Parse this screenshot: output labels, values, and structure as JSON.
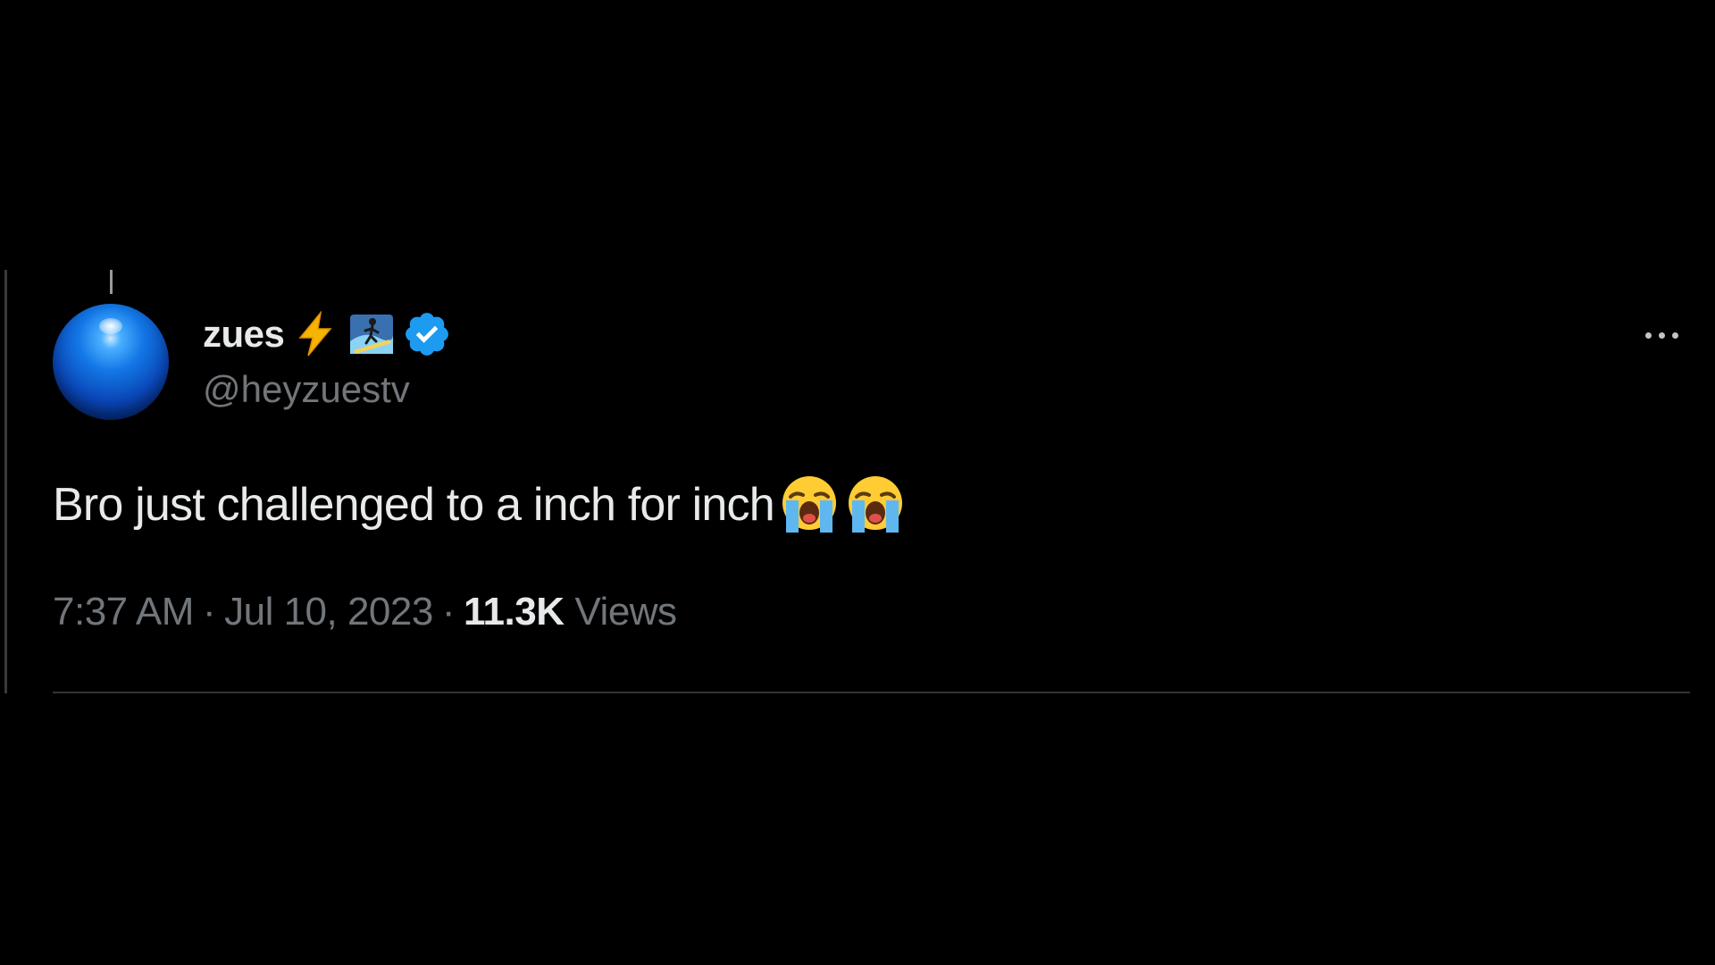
{
  "tweet": {
    "author": {
      "display_name": "zues",
      "handle": "@heyzuestv",
      "name_emojis": [
        "lightning-bolt-icon",
        "person-surfing-icon"
      ],
      "verified": true
    },
    "text": "Bro just challenged to a inch for inch",
    "text_emojis": [
      "loudly-crying-face-icon",
      "loudly-crying-face-icon"
    ],
    "time": "7:37 AM",
    "date": "Jul 10, 2023",
    "separator": "·",
    "views_count": "11.3K",
    "views_label": "Views"
  },
  "colors": {
    "background": "#000000",
    "primary_text": "#e7e9ea",
    "secondary_text": "#71767b",
    "verified_blue": "#1d9bf0",
    "divider": "#2f3336"
  }
}
